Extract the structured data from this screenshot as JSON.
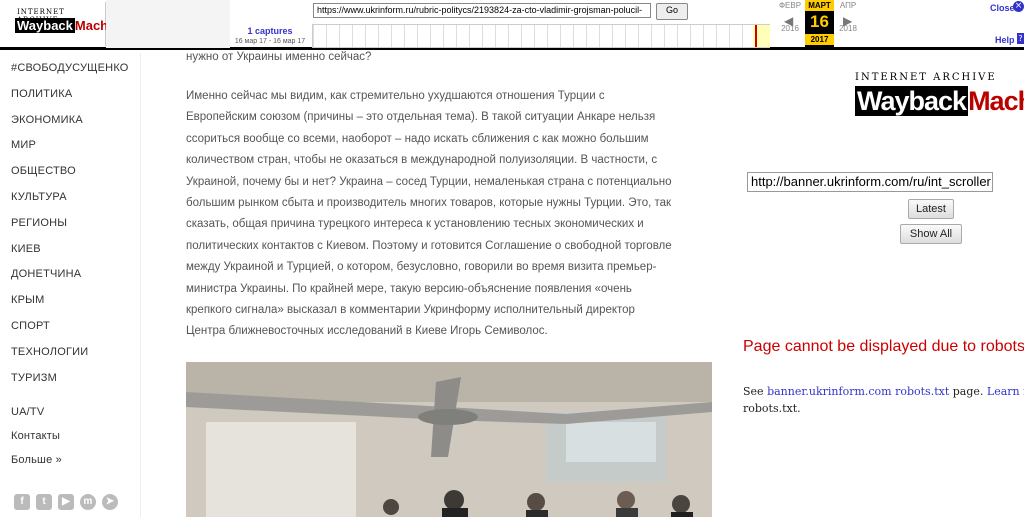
{
  "toolbar": {
    "logo_top": "INTERNET ARCHIVE",
    "logo_main_a": "Wayback",
    "logo_main_b": "Machine",
    "url_value": "https://www.ukrinform.ru/rubric-politycs/2193824-za-cto-vladimir-grojsman-polucil-",
    "go_label": "Go",
    "captures_count": "1 captures",
    "captures_range": "16 мар 17 - 16 мар 17",
    "prev_month": "ФЕВР",
    "prev_year": "2016",
    "cur_month": "МАРТ",
    "cur_day": "16",
    "cur_year": "2017",
    "next_month": "АПР",
    "next_year": "2018",
    "close_label": "Close",
    "help_label": "Help",
    "capture_position": 0.97
  },
  "sidebar": {
    "items": [
      "#СВОБОДУСУЩЕНКО",
      "ПОЛИТИКА",
      "ЭКОНОМИКА",
      "МИР",
      "ОБЩЕСТВО",
      "КУЛЬТУРА",
      "РЕГИОНЫ",
      "КИЕВ",
      "ДОНЕТЧИНА",
      "КРЫМ",
      "СПОРТ",
      "ТЕХНОЛОГИИ",
      "ТУРИЗМ"
    ],
    "secondary": [
      "UA/TV",
      "Контакты",
      "Больше »"
    ],
    "social_icons": [
      "facebook-icon",
      "twitter-icon",
      "youtube-icon",
      "messenger-icon",
      "telegram-icon"
    ]
  },
  "article": {
    "cut_line": "нужно от Украины именно сейчас?",
    "lines": [
      "Именно сейчас мы видим, как стремительно ухудшаются отношения Турции с",
      "Европейским союзом (причины – это отдельная тема). В такой ситуации Анкаре нельзя",
      "ссориться вообще со всеми, наоборот – надо искать сближения с как можно большим",
      "количеством стран, чтобы не оказаться в международной полуизоляции. В частности, с",
      "Украиной, почему бы и нет? Украина – сосед Турции, немаленькая страна с потенциально",
      "большим рынком сбыта и производитель многих товаров, которые нужны Турции. Это, так",
      "сказать, общая причина турецкого интереса к установлению тесных экономических и",
      "политических контактов с Киевом. Поэтому и готовится Соглашение о свободной торговле",
      "между Украиной и Турцией, о котором, безусловно, говорили во время визита премьер-",
      "министра Украины. По крайней мере, такую версию-объяснение появления «очень",
      "крепкого сигнала» высказал в комментарии Укринформу исполнительный директор",
      "Центра ближневосточных исследований в Киеве Игорь Семиволос."
    ]
  },
  "wayback_panel": {
    "logo_top": "INTERNET ARCHIVE",
    "logo_main_a": "Wayback",
    "logo_main_b": "Machine",
    "banner_url": "http://banner.ukrinform.com/ru/int_scroller",
    "latest_label": "Latest",
    "show_all_label": "Show All",
    "error_message": "Page cannot be displayed due to robots.txt.",
    "note_see": "See",
    "note_link": "banner.ukrinform.com robots.txt",
    "note_page": "page.",
    "note_learn": "Learn more about",
    "note_tail": "robots.txt."
  }
}
